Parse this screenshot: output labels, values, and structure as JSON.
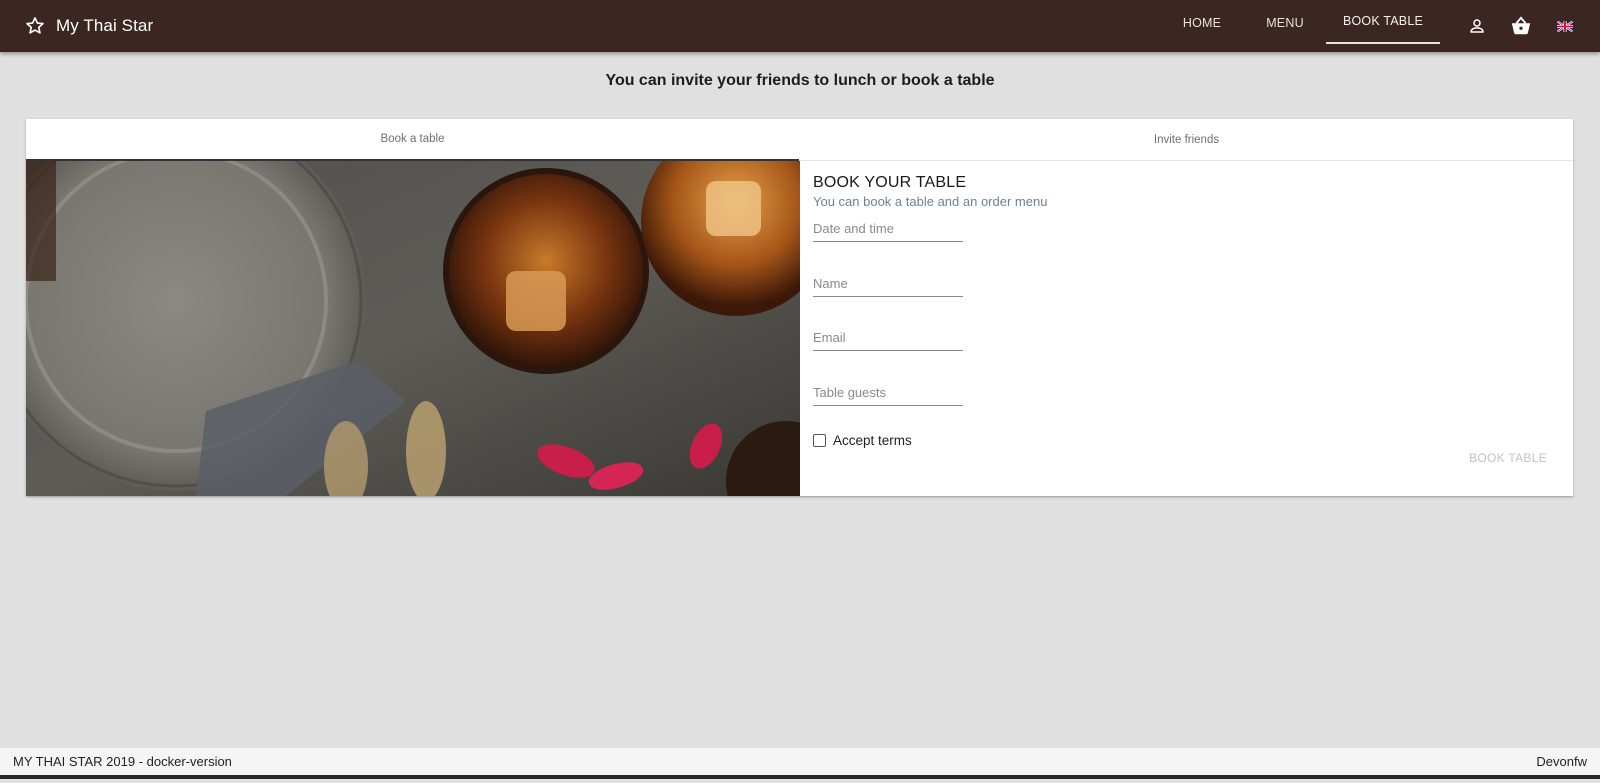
{
  "app": {
    "title": "My Thai Star"
  },
  "nav": {
    "home": "HOME",
    "menu": "MENU",
    "book_table": "BOOK TABLE"
  },
  "toolbar_icons": {
    "user": "account-icon",
    "cart": "basket-icon",
    "language": "uk-flag-icon"
  },
  "page": {
    "heading": "You can invite your friends to lunch or book a table"
  },
  "tabs": [
    {
      "label": "Book a table",
      "active": true
    },
    {
      "label": "Invite friends",
      "active": false
    }
  ],
  "form": {
    "title": "BOOK YOUR TABLE",
    "subtitle": "You can book a table and an order menu",
    "fields": {
      "date_time": {
        "placeholder": "Date and time",
        "value": ""
      },
      "name": {
        "placeholder": "Name",
        "value": ""
      },
      "email": {
        "placeholder": "Email",
        "value": ""
      },
      "guests": {
        "placeholder": "Table guests",
        "value": ""
      }
    },
    "accept_terms": {
      "label": "Accept terms",
      "checked": false
    },
    "submit_label": "BOOK TABLE"
  },
  "footer": {
    "left": "MY THAI STAR 2019 - docker-version",
    "right": "Devonfw"
  },
  "colors": {
    "toolbar": "#3c2622",
    "background": "#e0e0e0",
    "subtitle": "#6b8394",
    "disabled_button": "#c2c2c2"
  }
}
